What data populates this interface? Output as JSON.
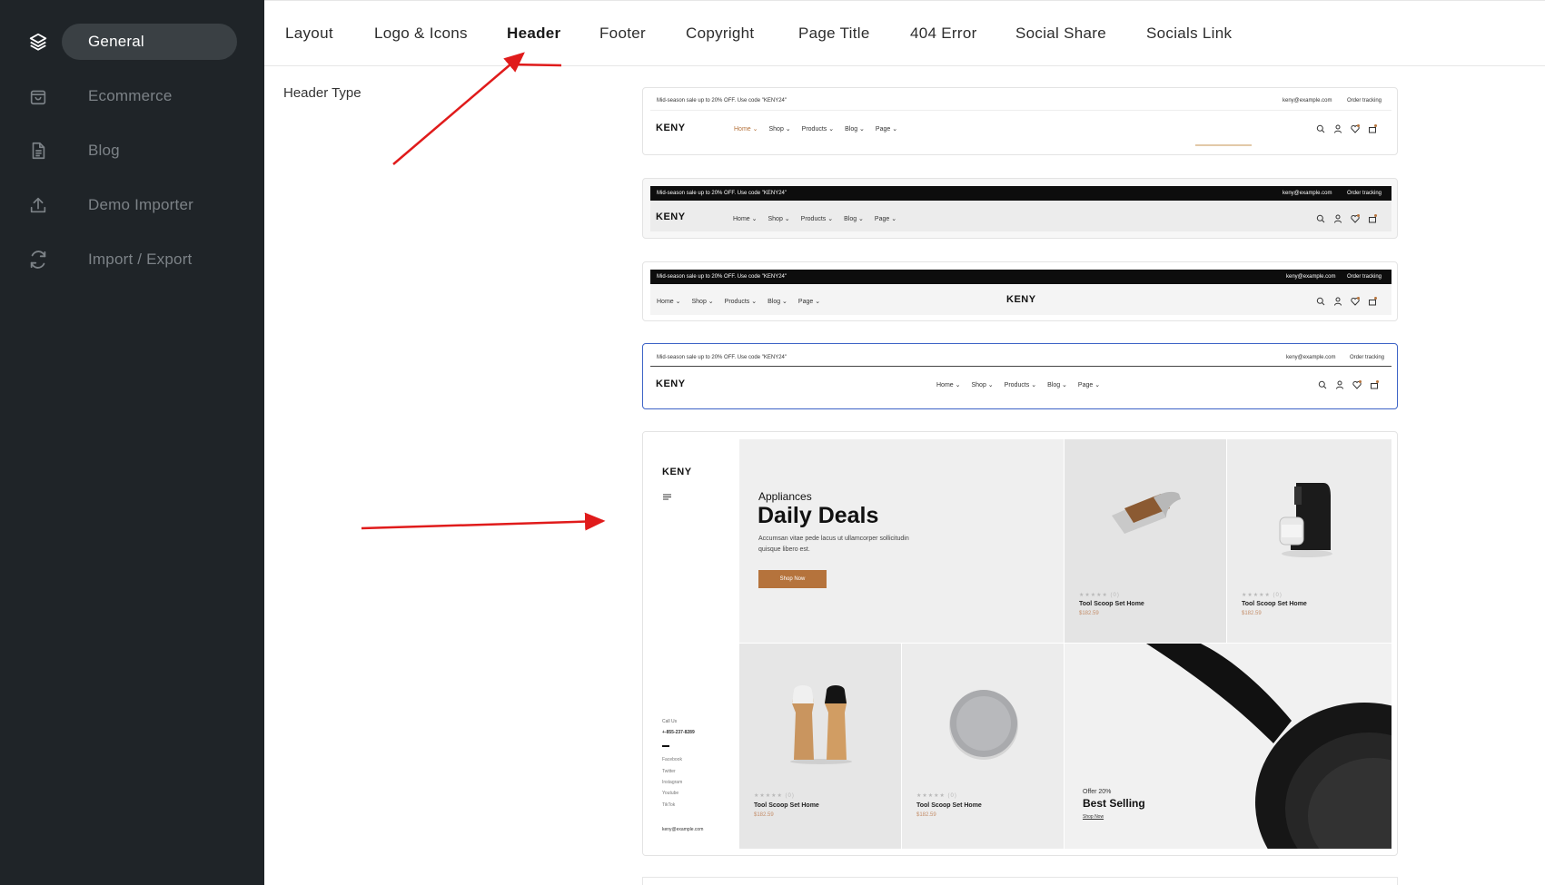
{
  "sidebar": {
    "items": [
      {
        "label": "General",
        "icon": "layers-icon",
        "active": true
      },
      {
        "label": "Ecommerce",
        "icon": "shopping-bag-icon",
        "active": false
      },
      {
        "label": "Blog",
        "icon": "document-icon",
        "active": false
      },
      {
        "label": "Demo Importer",
        "icon": "upload-icon",
        "active": false
      },
      {
        "label": "Import / Export",
        "icon": "sync-icon",
        "active": false
      }
    ]
  },
  "tabs": [
    {
      "label": "Layout"
    },
    {
      "label": "Logo & Icons"
    },
    {
      "label": "Header",
      "active": true
    },
    {
      "label": "Footer"
    },
    {
      "label": "Copyright"
    },
    {
      "label": "Page Title"
    },
    {
      "label": "404 Error"
    },
    {
      "label": "Social Share"
    },
    {
      "label": "Socials Link"
    }
  ],
  "section": {
    "label": "Header Type"
  },
  "header_preview": {
    "promo": "Mid-season sale up to 20% OFF. Use code \"KENY24\"",
    "email": "keny@example.com",
    "tracking": "Order tracking",
    "logo": "KENY",
    "menu": [
      "Home",
      "Shop",
      "Products",
      "Blog",
      "Page"
    ]
  },
  "preview": {
    "logo": "KENY",
    "hero_kicker": "Appliances",
    "hero_title": "Daily Deals",
    "hero_desc_1": "Accumsan vitae pede lacus ut ullamcorper sollicitudin",
    "hero_desc_2": "quisque libero est.",
    "hero_button": "Shop Now",
    "product_name": "Tool Scoop Set Home",
    "product_price": "$182.59",
    "stars": "★★★★★ (0)",
    "offer_small": "Offer 20%",
    "offer_title": "Best Selling",
    "offer_link": "Shop Now",
    "call_label": "Call Us",
    "phone": "+-855-237-8289",
    "socials": [
      "Facebook",
      "Twitter",
      "Instagram",
      "Youtube",
      "TikTok"
    ],
    "email": "keny@example.com"
  },
  "colors": {
    "sidebar_bg": "#1f2428",
    "active_pill": "#3a4044",
    "accent": "#b5733c",
    "selected_border": "#3d63c6",
    "annotation_arrow": "#e01b1b"
  }
}
